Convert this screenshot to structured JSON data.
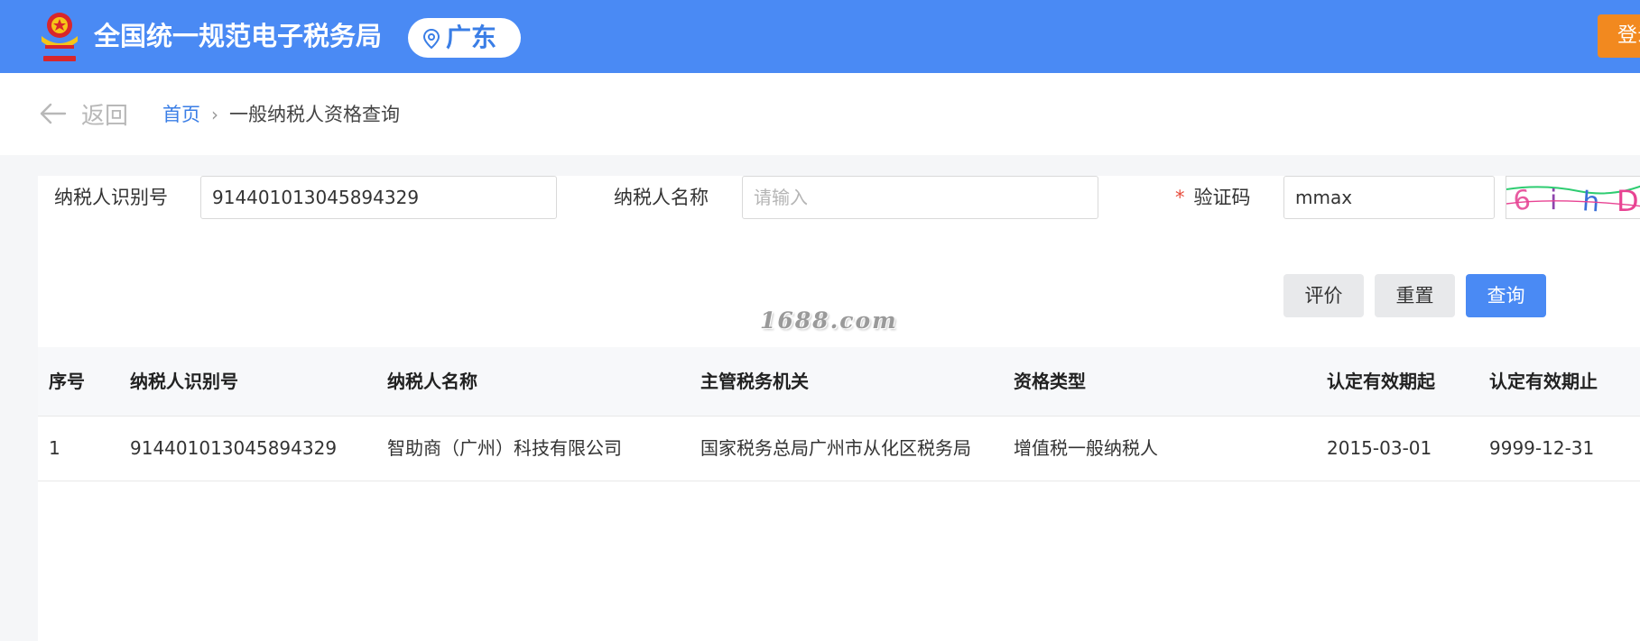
{
  "header": {
    "site_title": "全国统一规范电子税务局",
    "region": "广东",
    "login_label": "登录"
  },
  "nav": {
    "back_label": "返回",
    "breadcrumb": {
      "home": "首页",
      "separator": "›",
      "current": "一般纳税人资格查询"
    }
  },
  "form": {
    "taxpayer_id": {
      "label": "纳税人识别号",
      "value": "914401013045894329"
    },
    "taxpayer_name": {
      "label": "纳税人名称",
      "value": "",
      "placeholder": "请输入"
    },
    "captcha": {
      "required_mark": "*",
      "label": "验证码",
      "value": "mmax",
      "image_text": "6ihD"
    },
    "buttons": {
      "evaluate": "评价",
      "reset": "重置",
      "query": "查询"
    }
  },
  "watermark": "1688.com",
  "table": {
    "columns": [
      "序号",
      "纳税人识别号",
      "纳税人名称",
      "主管税务机关",
      "资格类型",
      "认定有效期起",
      "认定有效期止"
    ],
    "rows": [
      [
        "1",
        "914401013045894329",
        "智助商（广州）科技有限公司",
        "国家税务总局广州市从化区税务局",
        "增值税一般纳税人",
        "2015-03-01",
        "9999-12-31"
      ]
    ]
  },
  "colors": {
    "header_bg": "#4a8af4",
    "primary": "#4a8af4",
    "login_btn": "#f2891f",
    "required": "#e74c3c"
  }
}
